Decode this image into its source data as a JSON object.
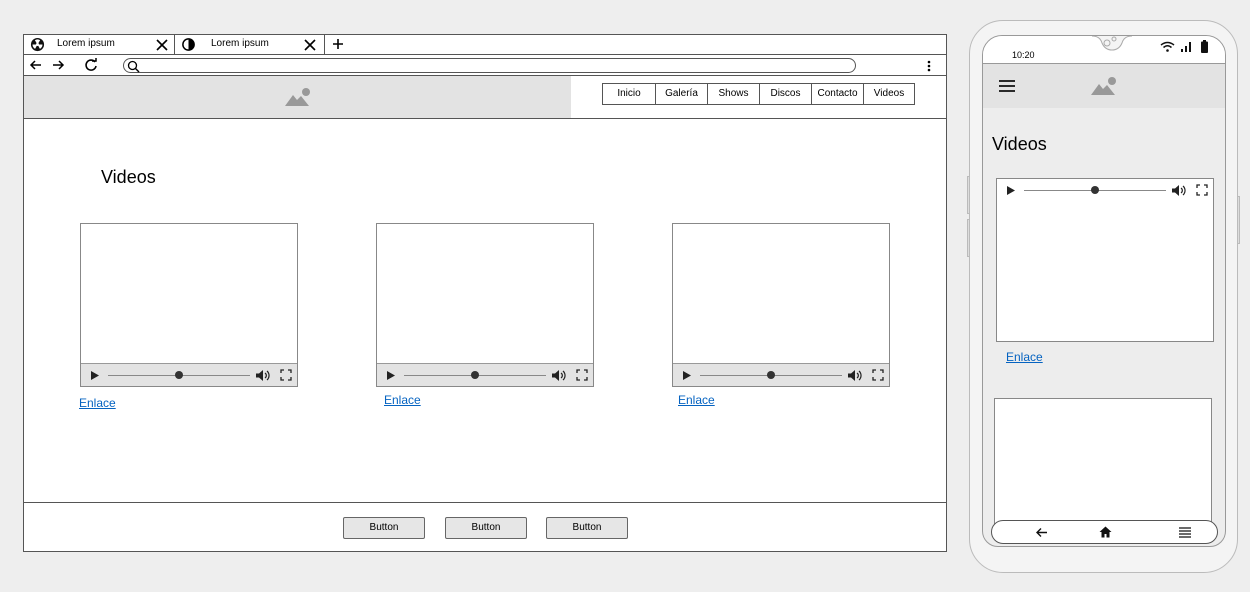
{
  "browser": {
    "tabs": [
      {
        "label": "Lorem ipsum",
        "icon": "radiation-icon"
      },
      {
        "label": "Lorem ipsum",
        "icon": "contrast-icon"
      }
    ]
  },
  "site": {
    "nav": [
      {
        "label": "Inicio"
      },
      {
        "label": "Galería"
      },
      {
        "label": "Shows"
      },
      {
        "label": "Discos"
      },
      {
        "label": "Contacto"
      },
      {
        "label": "Videos"
      }
    ],
    "page_title": "Videos",
    "videos": [
      {
        "link_label": "Enlace",
        "progress": 0.5
      },
      {
        "link_label": "Enlace",
        "progress": 0.5
      },
      {
        "link_label": "Enlace",
        "progress": 0.5
      }
    ],
    "footer_buttons": [
      {
        "label": "Button"
      },
      {
        "label": "Button"
      },
      {
        "label": "Button"
      }
    ]
  },
  "phone": {
    "time": "10:20",
    "page_title": "Videos",
    "videos": [
      {
        "link_label": "Enlace",
        "progress": 0.5
      }
    ],
    "softkeys": [
      "back-arrow-icon",
      "home-icon",
      "recent-apps-icon"
    ]
  },
  "colors": {
    "link": "#0563c1",
    "header_bg": "#e3e3e3",
    "page_bg": "#eeeeee"
  }
}
